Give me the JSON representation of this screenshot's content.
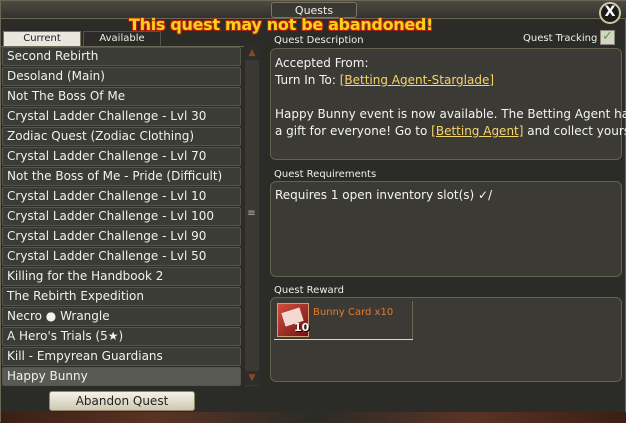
{
  "window": {
    "title": "Quests",
    "close_label": "X",
    "warning": "This quest may not be abandoned!"
  },
  "tabs": [
    {
      "label": "Current",
      "selected": true
    },
    {
      "label": "Available",
      "selected": false
    }
  ],
  "quest_list": {
    "items": [
      {
        "label": "Second Rebirth"
      },
      {
        "label": "Desoland (Main)"
      },
      {
        "label": "Not The Boss Of Me"
      },
      {
        "label": "Crystal Ladder Challenge - Lvl 30"
      },
      {
        "label": "Zodiac Quest (Zodiac Clothing)"
      },
      {
        "label": "Crystal Ladder Challenge - Lvl 70"
      },
      {
        "label": "Not the Boss of Me - Pride (Difficult)"
      },
      {
        "label": "Crystal Ladder Challenge - Lvl 10"
      },
      {
        "label": "Crystal Ladder Challenge - Lvl 100"
      },
      {
        "label": "Crystal Ladder Challenge - Lvl 90"
      },
      {
        "label": "Crystal Ladder Challenge - Lvl 50"
      },
      {
        "label": "Killing for the Handbook 2"
      },
      {
        "label": "The Rebirth Expedition"
      },
      {
        "label": "Necro ● Wrangle"
      },
      {
        "label": "A Hero's Trials (5★)"
      },
      {
        "label": "Kill - Empyrean Guardians"
      },
      {
        "label": "Happy Bunny",
        "selected": true
      }
    ]
  },
  "abandon_button": {
    "label": "Abandon Quest"
  },
  "quest_tracking": {
    "label": "Quest Tracking",
    "checked": true
  },
  "description": {
    "header": "Quest Description",
    "accepted_from": "Accepted From:",
    "turn_in_label": "Turn In To:",
    "turn_in_link": "[Betting Agent-Starglade]",
    "body_line1": "Happy Bunny event is now available. The Betting Agent has",
    "body_line2_prefix": "a gift for everyone! Go to",
    "body_line2_link": "[Betting Agent]",
    "body_line2_suffix": "and collect yours!"
  },
  "requirements": {
    "header": "Quest Requirements",
    "line1": "Requires 1 open inventory slot(s) ✓/"
  },
  "reward": {
    "header": "Quest Reward",
    "item_name": "Bunny Card x10",
    "quantity": "10",
    "icon": "bunny-card-icon"
  }
}
